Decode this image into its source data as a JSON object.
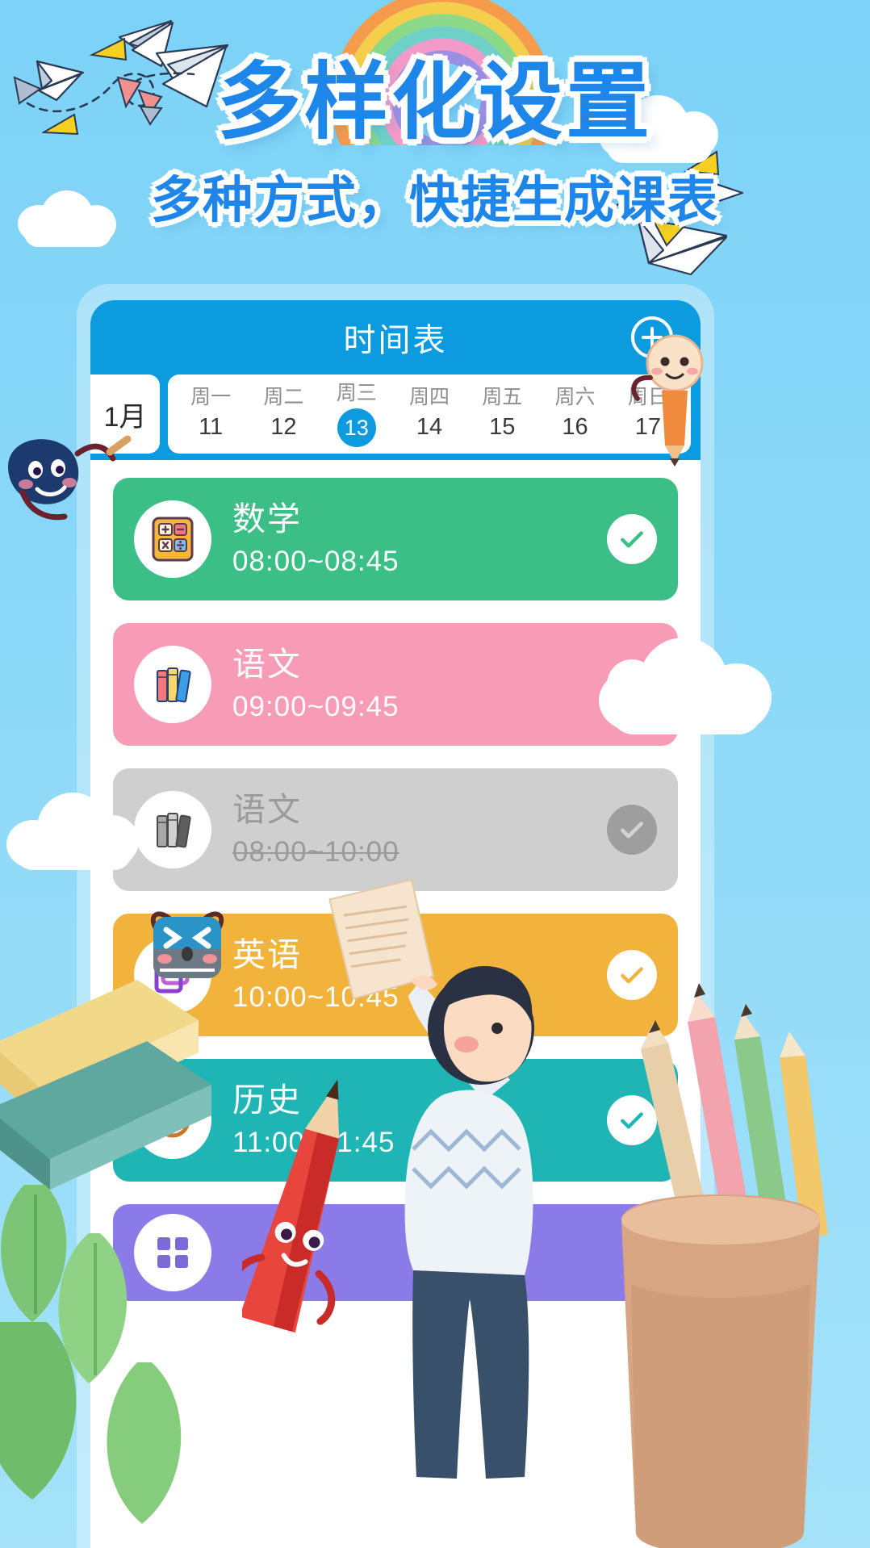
{
  "promo": {
    "headline": "多样化设置",
    "subhead": "多种方式，快捷生成课表",
    "bg_color": "#7CD2F7",
    "text_color": "#1E86E8"
  },
  "app": {
    "header": {
      "title": "时间表",
      "add_button_icon": "plus-circle-icon",
      "bar_color": "#0D9BE0"
    },
    "date_bar": {
      "month": "1月",
      "selected_date": "13",
      "days": [
        {
          "weekday": "周一",
          "date": "11",
          "selected": false
        },
        {
          "weekday": "周二",
          "date": "12",
          "selected": false
        },
        {
          "weekday": "周三",
          "date": "13",
          "selected": true
        },
        {
          "weekday": "周四",
          "date": "14",
          "selected": false
        },
        {
          "weekday": "周五",
          "date": "15",
          "selected": false
        },
        {
          "weekday": "周六",
          "date": "16",
          "selected": false
        },
        {
          "weekday": "周日",
          "date": "17",
          "selected": false
        }
      ]
    },
    "courses": [
      {
        "subject": "数学",
        "time": "08:00~08:45",
        "color": "#3BBF86",
        "icon": "calculator-icon",
        "state": "active"
      },
      {
        "subject": "语文",
        "time": "09:00~09:45",
        "color": "#F79BB6",
        "icon": "books-icon",
        "state": "active"
      },
      {
        "subject": "语文",
        "time": "08:00~10:00",
        "color": "#CFCFCF",
        "icon": "books-gray-icon",
        "state": "done"
      },
      {
        "subject": "英语",
        "time": "10:00~10:45",
        "color": "#F2B33D",
        "icon": "folder-icon",
        "state": "active"
      },
      {
        "subject": "历史",
        "time": "11:00~11:45",
        "color": "#1FB5B5",
        "icon": "history-icon",
        "state": "active"
      },
      {
        "subject": "",
        "time": "",
        "color": "#8B7BE8",
        "icon": "grid-icon",
        "state": "active"
      }
    ]
  }
}
